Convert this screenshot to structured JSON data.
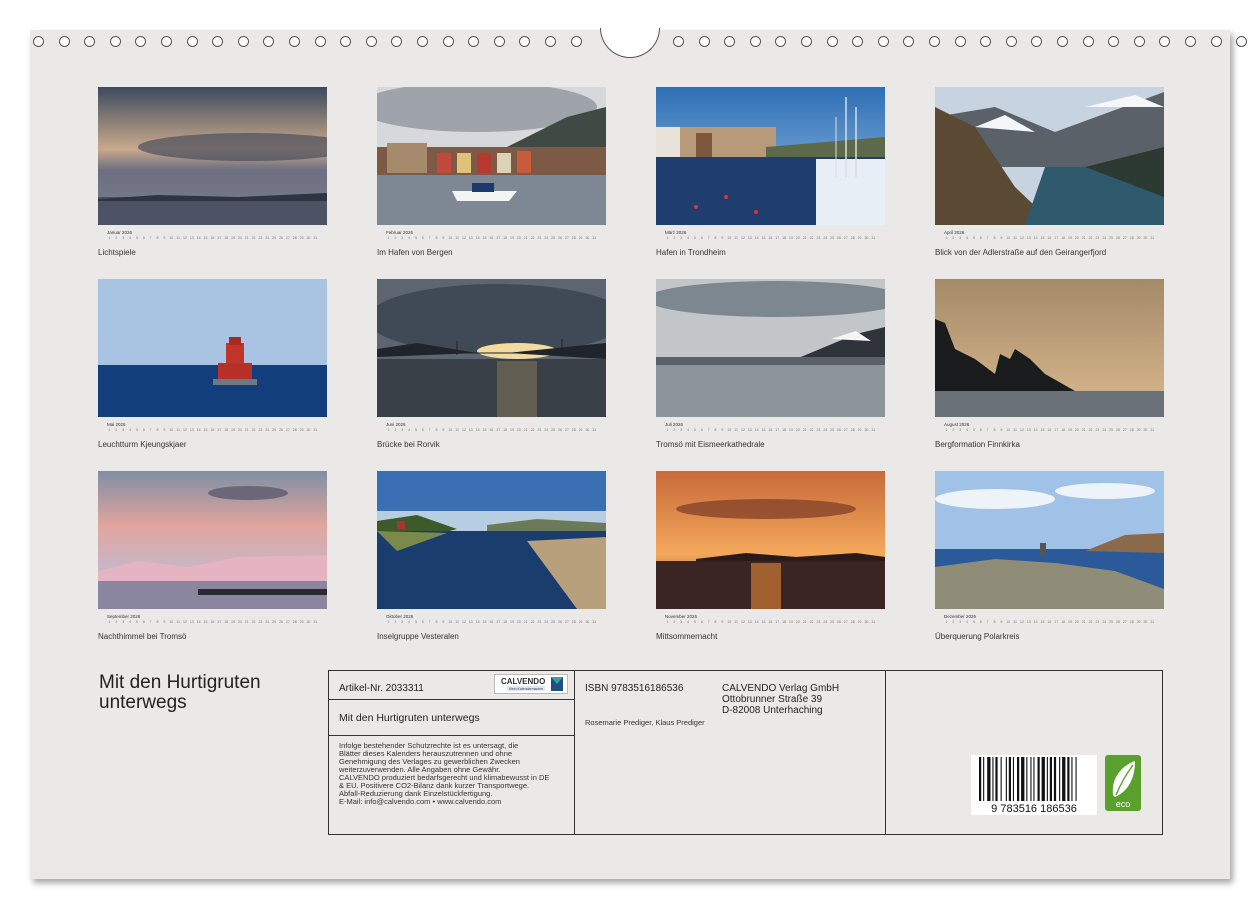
{
  "calendar": {
    "months": [
      {
        "label": "Januar 2026",
        "caption": "Lichtspiele",
        "scene": "stormy-sky"
      },
      {
        "label": "Februar 2026",
        "caption": "Im Hafen von Bergen",
        "scene": "bergen-harbour"
      },
      {
        "label": "März 2026",
        "caption": "Hafen in Trondheim",
        "scene": "trondheim-harbour"
      },
      {
        "label": "April 2026",
        "caption": "Blick von der Adlerstraße auf den Geirangerfjord",
        "scene": "geirangerfjord"
      },
      {
        "label": "Mai 2026",
        "caption": "Leuchtturm Kjeungskjaer",
        "scene": "lighthouse"
      },
      {
        "label": "Juni 2026",
        "caption": "Brücke bei Rorvik",
        "scene": "bridge-sunset"
      },
      {
        "label": "Juli 2026",
        "caption": "Tromsö mit Eismeerkathedrale",
        "scene": "tromso"
      },
      {
        "label": "August 2026",
        "caption": "Bergformation Finnkirka",
        "scene": "finnkirka"
      },
      {
        "label": "September 2026",
        "caption": "Nachthimmel bei Tromsö",
        "scene": "pink-sky"
      },
      {
        "label": "Oktober 2026",
        "caption": "Inselgruppe Vesteralen",
        "scene": "vesteralen"
      },
      {
        "label": "November 2026",
        "caption": "Mittsommernacht",
        "scene": "midnight-sun"
      },
      {
        "label": "Dezember 2026",
        "caption": "Überquerung Polarkreis",
        "scene": "polar-circle"
      }
    ]
  },
  "title_lines": [
    "Mit den Hurtigruten",
    "unterwegs"
  ],
  "info": {
    "article": "Artikel-Nr. 2033311",
    "logo_text": "CALVENDO",
    "logo_sub": "Mein Kalendermacher",
    "calendar_title": "Mit den Hurtigruten unterwegs",
    "legal": [
      "Infolge bestehender Schutzrechte ist es untersagt, die",
      "Blätter dieses Kalenders herauszutrennen und ohne",
      "Genehmigung des Verlages zu gewerblichen Zwecken",
      "weiterzuverwenden. Alle Angaben ohne Gewähr.",
      "CALVENDO produziert bedarfsgerecht und klimabewusst in DE",
      "& EU. Positivere CO2-Bilanz dank kurzer Transportwege.",
      "Abfall-Reduzierung dank Einzelstückfertigung.",
      "E-Mail: info@calvendo.com • www.calvendo.com"
    ],
    "isbn": "ISBN 9783516186536",
    "authors": "Rosemarie Prediger, Klaus Prediger",
    "publisher_lines": [
      "CALVENDO Verlag GmbH",
      "Ottobrunner Straße 39",
      "D-82008 Unterhaching"
    ],
    "barcode_number": "9 783516 186536",
    "eco_label": "eco"
  }
}
